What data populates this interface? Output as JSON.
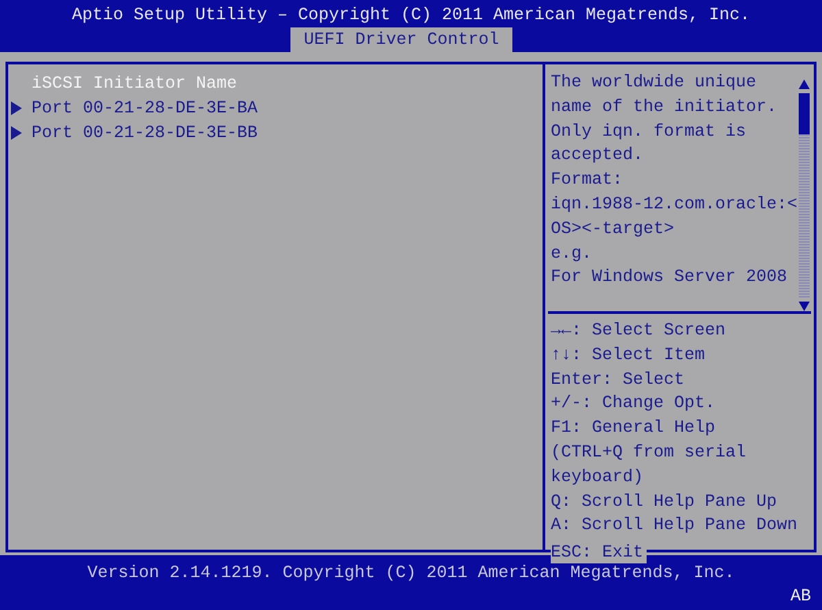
{
  "header": {
    "title": "Aptio Setup Utility – Copyright (C) 2011 American Megatrends, Inc.",
    "tabs": [
      {
        "label": "UEFI Driver Control",
        "selected": true
      }
    ]
  },
  "menu": {
    "items": [
      {
        "label": "iSCSI Initiator Name",
        "kind": "label",
        "selected": true
      },
      {
        "label": "Port 00-21-28-DE-3E-BA",
        "kind": "submenu",
        "selected": false
      },
      {
        "label": "Port 00-21-28-DE-3E-BB",
        "kind": "submenu",
        "selected": false
      }
    ]
  },
  "help": {
    "lines": [
      "The worldwide unique",
      "name of the initiator.",
      "Only iqn. format is",
      "accepted.",
      "Format:",
      "iqn.1988-12.com.oracle:<",
      "OS><-target>",
      "e.g.",
      "For Windows Server 2008"
    ]
  },
  "keys": {
    "lines": [
      "→←: Select Screen",
      "↑↓: Select Item",
      "Enter: Select",
      "+/-: Change Opt.",
      "F1: General Help",
      "(CTRL+Q from serial",
      "keyboard)",
      "Q: Scroll Help Pane Up",
      "A: Scroll Help Pane Down"
    ],
    "exit": "ESC: Exit"
  },
  "footer": {
    "version": "Version 2.14.1219. Copyright (C) 2011 American Megatrends, Inc.",
    "badge": "AB"
  }
}
